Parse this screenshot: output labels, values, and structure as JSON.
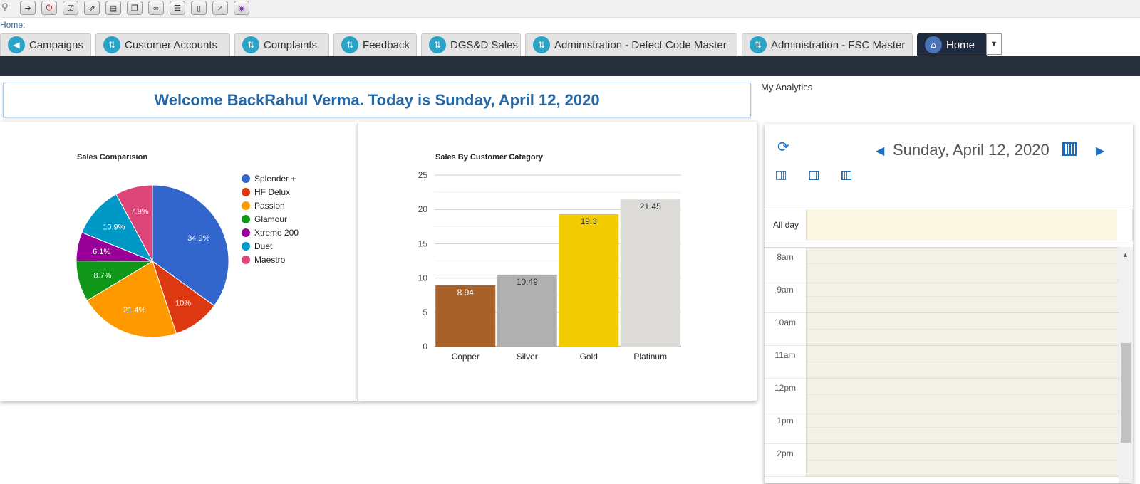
{
  "toolbar": {
    "icons": [
      "search-icon",
      "go-icon",
      "power-icon",
      "checklist-icon",
      "export-icon",
      "document-icon",
      "copy-icon",
      "link-icon",
      "list-icon",
      "clipboard-icon",
      "chart-icon",
      "report-icon"
    ]
  },
  "breadcrumb": "Home:",
  "tabs": [
    {
      "label": "Campaigns",
      "icon": "megaphone-icon"
    },
    {
      "label": "Customer Accounts",
      "icon": "module-icon"
    },
    {
      "label": "Complaints",
      "icon": "module-icon"
    },
    {
      "label": "Feedback",
      "icon": "module-icon"
    },
    {
      "label": "DGS&D Sales",
      "icon": "module-icon"
    },
    {
      "label": "Administration - Defect Code Master",
      "icon": "module-icon"
    },
    {
      "label": "Administration - FSC Master",
      "icon": "module-icon"
    },
    {
      "label": "Home",
      "icon": "home-icon",
      "active": true
    }
  ],
  "tab_more": "▼",
  "welcome": "Welcome BackRahul Verma.  Today is Sunday, April 12, 2020",
  "my_analytics": "My Analytics",
  "chart_data": [
    {
      "type": "pie",
      "title": "Sales Comparision",
      "categories": [
        "Splender +",
        "HF Delux",
        "Passion",
        "Glamour",
        "Xtreme 200",
        "Duet",
        "Maestro"
      ],
      "values": [
        34.9,
        10,
        21.4,
        8.7,
        6.1,
        10.9,
        7.9
      ],
      "labels": [
        "34.9%",
        "10%",
        "21.4%",
        "8.7%",
        "6.1%",
        "10.9%",
        "7.9%"
      ],
      "colors": [
        "#3366cc",
        "#dc3912",
        "#ff9900",
        "#109618",
        "#990099",
        "#0099c6",
        "#dd4477"
      ],
      "legend": "right"
    },
    {
      "type": "bar",
      "title": "Sales By Customer Category",
      "categories": [
        "Copper",
        "Silver",
        "Gold",
        "Platinum"
      ],
      "values": [
        8.94,
        10.49,
        19.3,
        21.45
      ],
      "colors": [
        "#a9612a",
        "#b0b0b0",
        "#f2cc00",
        "#dcdbd7"
      ],
      "label_colors": [
        "#ffffff",
        "#333333",
        "#333333",
        "#333333"
      ],
      "ylim": [
        0,
        25
      ],
      "yticks": [
        0,
        5,
        10,
        15,
        20,
        25
      ],
      "grid": true
    }
  ],
  "calendar": {
    "date": "Sunday, April 12, 2020",
    "all_day_label": "All day",
    "times": [
      "8am",
      "9am",
      "10am",
      "11am",
      "12pm",
      "1pm",
      "2pm"
    ]
  }
}
